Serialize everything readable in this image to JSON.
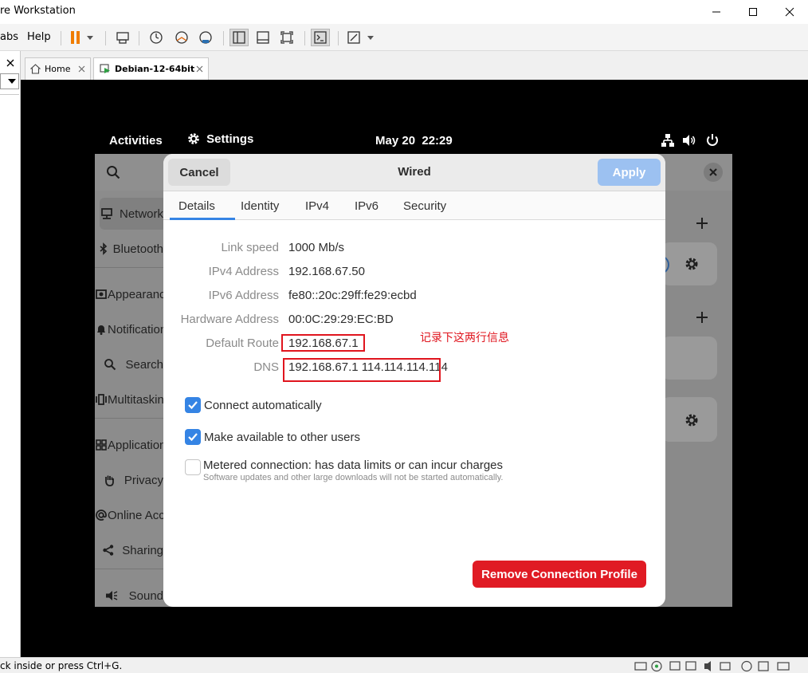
{
  "window": {
    "title": "re Workstation"
  },
  "menu": {
    "tabs_label": "abs",
    "help_label": "Help"
  },
  "tabs": [
    {
      "label": "Home"
    },
    {
      "label": "Debian-12-64bit"
    }
  ],
  "gnome_topbar": {
    "activities": "Activities",
    "settings": "Settings",
    "datetime": "May 20  22:29"
  },
  "settings_sidebar": [
    {
      "label": "Network",
      "icon": "network-icon"
    },
    {
      "label": "Bluetooth",
      "icon": "bluetooth-icon"
    },
    {
      "label": "Appearance",
      "icon": "appearance-icon"
    },
    {
      "label": "Notifications",
      "icon": "bell-icon"
    },
    {
      "label": "Search",
      "icon": "search-icon"
    },
    {
      "label": "Multitasking",
      "icon": "multitasking-icon"
    },
    {
      "label": "Applications",
      "icon": "apps-icon"
    },
    {
      "label": "Privacy",
      "icon": "hand-icon"
    },
    {
      "label": "Online Accounts",
      "icon": "at-icon"
    },
    {
      "label": "Sharing",
      "icon": "share-icon"
    },
    {
      "label": "Sound",
      "icon": "sound-icon"
    }
  ],
  "dialog": {
    "title": "Wired",
    "cancel_label": "Cancel",
    "apply_label": "Apply",
    "tabs": [
      "Details",
      "Identity",
      "IPv4",
      "IPv6",
      "Security"
    ],
    "active_tab": "Details",
    "details": [
      {
        "label": "Link speed",
        "value": "1000 Mb/s"
      },
      {
        "label": "IPv4 Address",
        "value": "192.168.67.50"
      },
      {
        "label": "IPv6 Address",
        "value": "fe80::20c:29ff:fe29:ecbd"
      },
      {
        "label": "Hardware Address",
        "value": "00:0C:29:29:EC:BD"
      },
      {
        "label": "Default Route",
        "value": "192.168.67.1"
      },
      {
        "label": "DNS",
        "value": "192.168.67.1 114.114.114.114"
      }
    ],
    "annotation": "记录下这两行信息",
    "connect_auto_label": "Connect automatically",
    "connect_auto_checked": true,
    "available_users_label": "Make available to other users",
    "available_users_checked": true,
    "metered_label": "Metered connection: has data limits or can incur charges",
    "metered_sub": "Software updates and other large downloads will not be started automatically.",
    "metered_checked": false,
    "remove_label": "Remove Connection Profile"
  },
  "status": {
    "text": "ck inside or press Ctrl+G."
  },
  "colors": {
    "accent": "#3584e4",
    "destructive": "#e01b24",
    "annotation": "#e0151e"
  }
}
